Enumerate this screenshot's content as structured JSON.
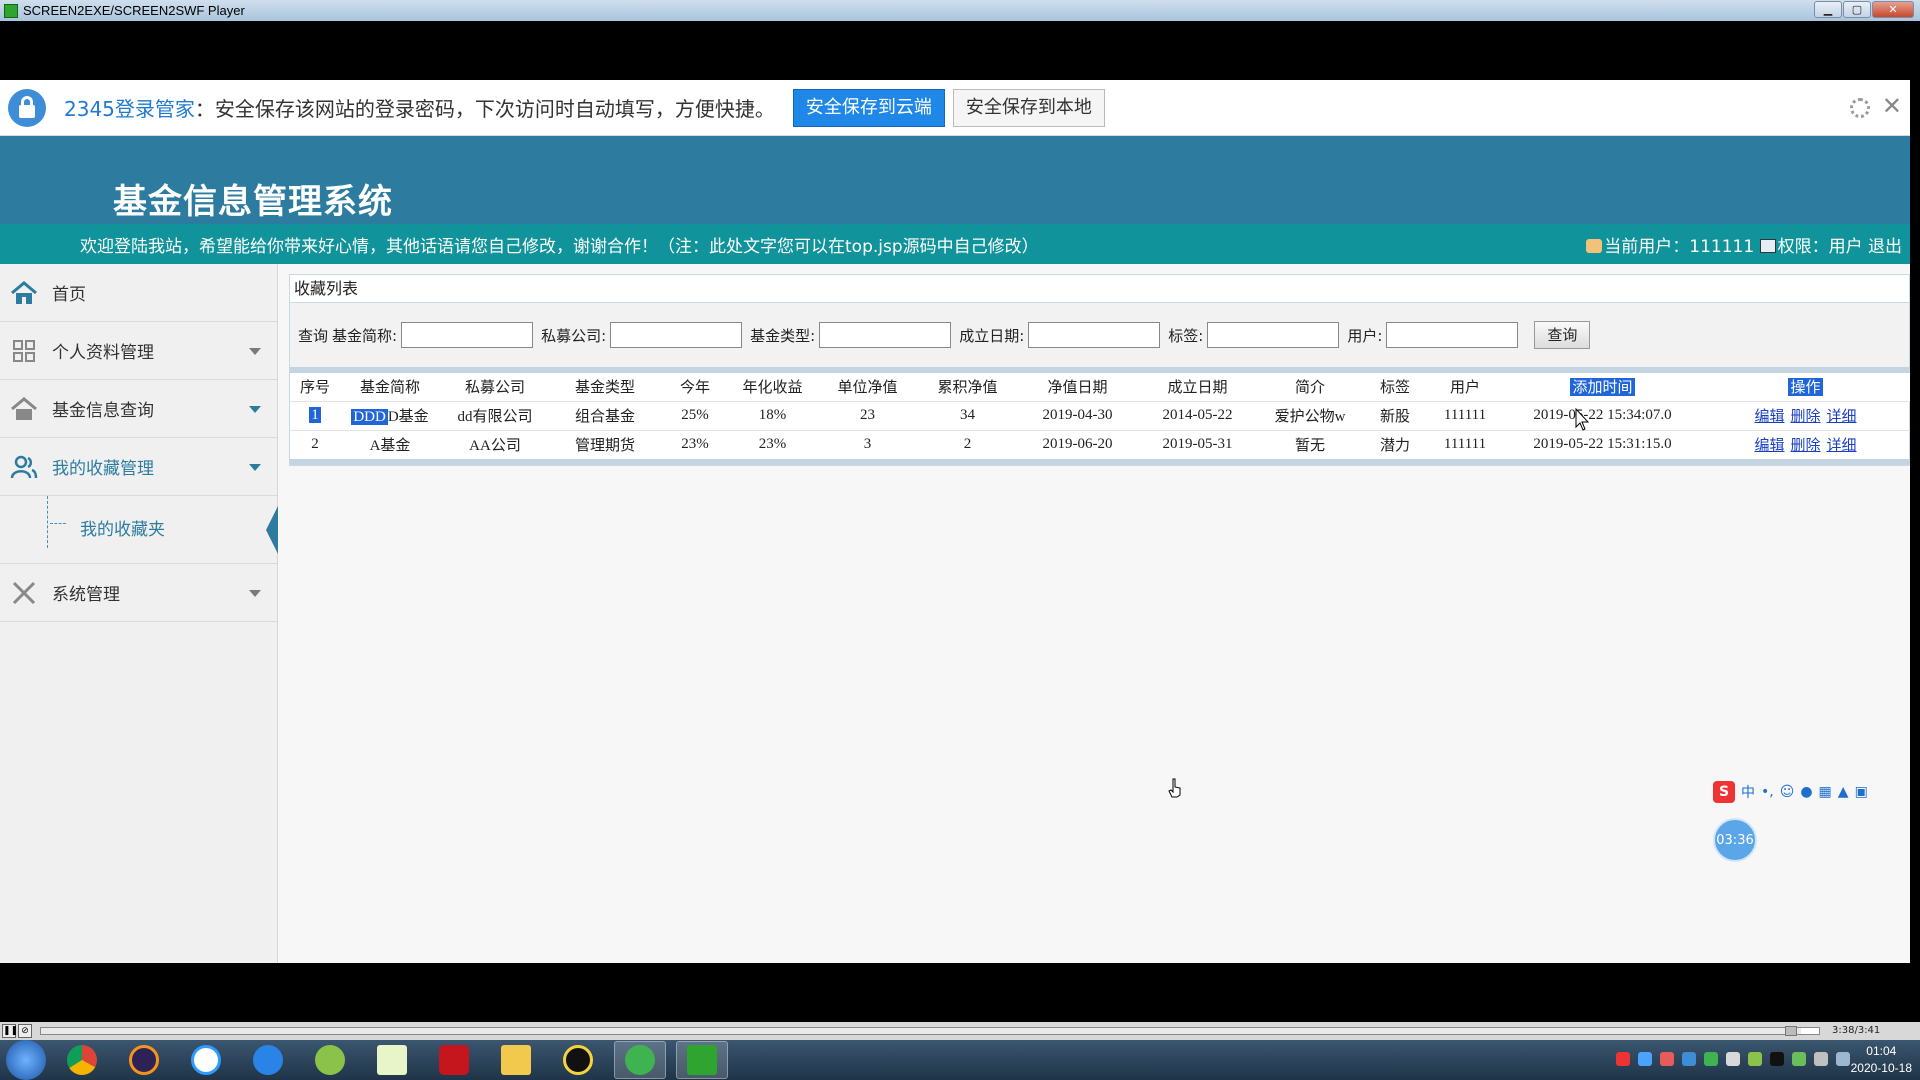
{
  "window": {
    "title": "SCREEN2EXE/SCREEN2SWF Player"
  },
  "password_bar": {
    "brand": "2345登录管家",
    "message": "：安全保存该网站的登录密码，下次访问时自动填写，方便快捷。",
    "save_cloud": "安全保存到云端",
    "save_local": "安全保存到本地"
  },
  "site": {
    "title": "基金信息管理系统",
    "marquee": "欢迎登陆我站，希望能给你带来好心情，其他话语请您自己修改，谢谢合作！（注：此处文字您可以在top.jsp源码中自己修改）",
    "current_user_label": "当前用户：111111",
    "rights_label": "权限：用户",
    "logout": "退出"
  },
  "sidebar": {
    "home": "首页",
    "personal": "个人资料管理",
    "fund_query": "基金信息查询",
    "favorites": "我的收藏管理",
    "favorites_sub": "我的收藏夹",
    "system": "系统管理"
  },
  "panel": {
    "title": "收藏列表",
    "search": {
      "query_label": "查询",
      "name_label": "基金简称:",
      "company_label": "私募公司:",
      "type_label": "基金类型:",
      "date_label": "成立日期:",
      "tag_label": "标签:",
      "user_label": "用户:",
      "button": "查询"
    }
  },
  "table": {
    "headers": [
      "序号",
      "基金简称",
      "私募公司",
      "基金类型",
      "今年",
      "年化收益",
      "单位净值",
      "累积净值",
      "净值日期",
      "成立日期",
      "简介",
      "标签",
      "用户",
      "添加时间",
      "操作"
    ],
    "rows": [
      {
        "no": "1",
        "name_sel": "DDD",
        "name": "D基金",
        "company": "dd有限公司",
        "type": "组合基金",
        "ytd": "25%",
        "annual": "18%",
        "unit_nav": "23",
        "acc_nav": "34",
        "nav_date": "2019-04-30",
        "setup_date": "2014-05-22",
        "intro": "爱护公物w",
        "tag": "新股",
        "user": "111111",
        "added": "2019-05-22 15:34:07.0"
      },
      {
        "no": "2",
        "name_sel": "",
        "name": "A基金",
        "company": "AA公司",
        "type": "管理期货",
        "ytd": "23%",
        "annual": "23%",
        "unit_nav": "3",
        "acc_nav": "2",
        "nav_date": "2019-06-20",
        "setup_date": "2019-05-31",
        "intro": "暂无",
        "tag": "潜力",
        "user": "111111",
        "added": "2019-05-22 15:31:15.0"
      }
    ],
    "ops": {
      "edit": "编辑",
      "delete": "删除",
      "detail": "详细"
    }
  },
  "ime": {
    "label": "中"
  },
  "timer": "03:36",
  "player": {
    "time": "3:38/3:41",
    "progress": 0.99
  },
  "taskbar": {
    "time": "01:04",
    "date": "2020-10-18"
  },
  "colors": {
    "header": "#2d7ca0",
    "infobar": "#10939a",
    "link": "#1a3fc2",
    "accent_button": "#1e87e8"
  }
}
